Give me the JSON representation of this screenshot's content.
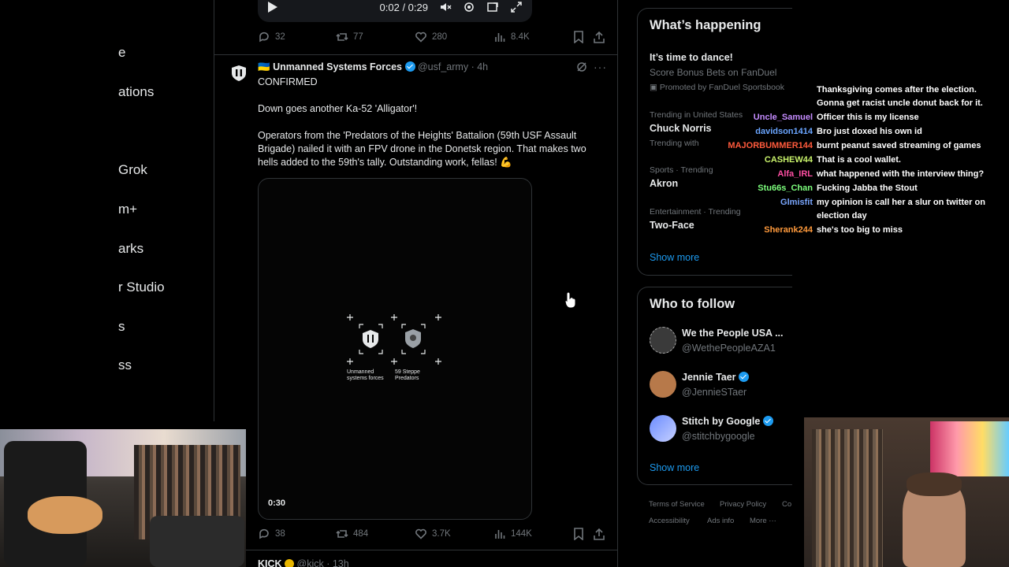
{
  "left_nav": {
    "items": [
      "e",
      "ations",
      "Grok",
      "m+",
      "arks",
      "r Studio",
      "s",
      "ss"
    ]
  },
  "feed": {
    "top_video": {
      "time": "0:02 / 0:29"
    },
    "top_actions": {
      "replies": "32",
      "reposts": "77",
      "likes": "280",
      "views": "8.4K"
    },
    "post": {
      "flag": "🇺🇦",
      "author_name": "Unmanned Systems Forces",
      "handle": "@usf_army",
      "time": "· 4h",
      "line1": "CONFIRMED",
      "line2": "Down goes another Ka-52 'Alligator'!",
      "line3": "Operators from the 'Predators of the Heights' Battalion (59th USF Assault Brigade) nailed it with an FPV drone in the Donetsk region. That makes two hells added to the 59th's tally.  Outstanding work, fellas! 💪",
      "media": {
        "duration": "0:30",
        "logo_left_text": "Unmanned systems forces",
        "logo_right_text": "59 Steppe Predators"
      },
      "actions": {
        "replies": "38",
        "reposts": "484",
        "likes": "3.7K",
        "views": "144K"
      }
    },
    "next_post": {
      "author_name": "KICK",
      "handle": "@kick · 13h"
    }
  },
  "sidebar": {
    "whats_happening": {
      "title": "What’s happening",
      "promo_title": "It’s time to dance!",
      "promo_sub": "Score Bonus Bets on FanDuel",
      "promo_meta": "Promoted by FanDuel Sportsbook",
      "trends": [
        {
          "meta": "Trending in United States",
          "name": "Chuck Norris"
        },
        {
          "meta": "Trending with",
          "name": ""
        },
        {
          "meta": "Sports · Trending",
          "name": "Akron"
        },
        {
          "meta": "Entertainment · Trending",
          "name": "Two-Face"
        }
      ],
      "show_more": "Show more"
    },
    "who_to_follow": {
      "title": "Who to follow",
      "accounts": [
        {
          "name": "We the People USA ...",
          "handle": "@WethePeopleAZA1",
          "color": "#3a3a3a"
        },
        {
          "name": "Jennie Taer",
          "handle": "@JennieSTaer",
          "color": "#b7794a"
        },
        {
          "name": "Stitch by Google",
          "handle": "@stitchbygoogle",
          "color": "#6b8cff"
        }
      ],
      "show_more": "Show more"
    },
    "footer": [
      "Terms of Service",
      "Privacy Policy",
      "Co",
      "Accessibility",
      "Ads info",
      "More ···"
    ]
  },
  "chat": [
    {
      "user": "",
      "color": "#ffffff",
      "msg": "Thanksgiving comes after the election. Gonna get racist uncle donut back for it."
    },
    {
      "user": "Uncle_Samuel",
      "color": "#c58cff",
      "msg": "Officer this is my license"
    },
    {
      "user": "davidson1414",
      "color": "#6aa5ff",
      "msg": "Bro just doxed his own id"
    },
    {
      "user": "MAJORBUMMER144",
      "color": "#ff5a3c",
      "msg": "burnt peanut saved streaming of games"
    },
    {
      "user": "CASHEW44",
      "color": "#c9f36b",
      "msg": "That is a cool wallet."
    },
    {
      "user": "Alfa_IRL",
      "color": "#ff4fa3",
      "msg": "what happened with the interview thing?"
    },
    {
      "user": "Stu66s_Chan",
      "color": "#7dff7d",
      "msg": "Fucking Jabba the Stout"
    },
    {
      "user": "Glmisfit",
      "color": "#7aa7ff",
      "msg": "my opinion is call her a slur on twitter on election day"
    },
    {
      "user": "Sherank244",
      "color": "#ff9a3c",
      "msg": "she's too big to miss"
    }
  ]
}
